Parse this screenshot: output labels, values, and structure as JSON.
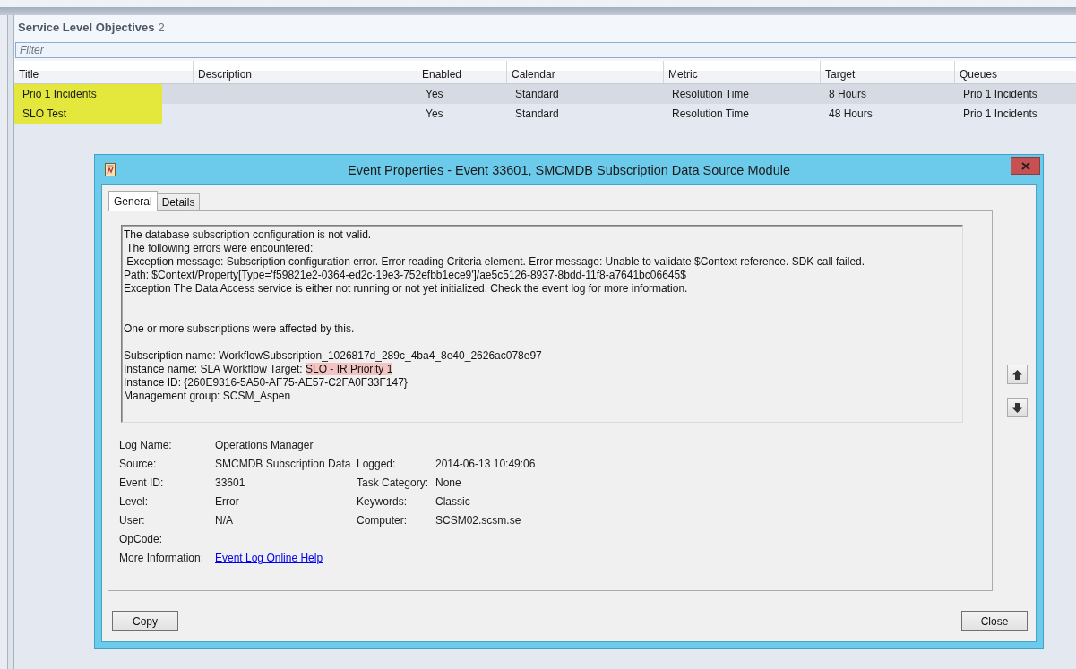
{
  "list_panel": {
    "title": "Service Level Objectives",
    "count": "2",
    "filter": {
      "placeholder": "Filter"
    }
  },
  "table": {
    "columns": [
      "Title",
      "Description",
      "Enabled",
      "Calendar",
      "Metric",
      "Target",
      "Queues"
    ],
    "rows": [
      {
        "title": "Prio 1 Incidents",
        "enabled": "Yes",
        "calendar": "Standard",
        "metric": "Resolution Time",
        "target": "8 Hours",
        "queues": "Prio 1 Incidents",
        "selected": true,
        "highlighted": true
      },
      {
        "title": "SLO Test",
        "enabled": "Yes",
        "calendar": "Standard",
        "metric": "Resolution Time",
        "target": "48 Hours",
        "queues": "Prio 1 Incidents",
        "selected": false,
        "highlighted": true
      }
    ]
  },
  "dialog": {
    "title": "Event Properties - Event 33601, SMCMDB Subscription Data Source Module",
    "tabs": [
      {
        "label": "General",
        "selected": true
      },
      {
        "label": "Details",
        "selected": false
      }
    ],
    "description": [
      {
        "text": "The database subscription configuration is not valid.\n The following errors were encountered:\n Exception message: Subscription configuration error. Error reading Criteria element. Error message: Unable to validate $Context reference. SDK call failed.\nPath: $Context/Property[Type='f59821e2-0364-ed2c-19e3-752efbb1ece9']/ae5c5126-8937-8bdd-11f8-a7641bc06645$\nException The Data Access service is either not running or not yet initialized. Check the event log for more information.\n\n\nOne or more subscriptions were affected by this.\n\nSubscription name: WorkflowSubscription_1026817d_289c_4ba4_8e40_2626ac078e97\nInstance name: SLA Workflow Target: ",
        "highlighted": false
      },
      {
        "text": "SLO - IR Priority 1",
        "highlighted": true
      },
      {
        "text": "\nInstance ID: {260E9316-5A50-AF75-AE57-C2FA0F33F147}\nManagement group: SCSM_Aspen",
        "highlighted": false
      }
    ],
    "properties": [
      [
        {
          "label": "Log Name:",
          "value": "Operations Manager"
        }
      ],
      [
        {
          "label": "Source:",
          "value": "SMCMDB Subscription Data"
        },
        {
          "label": "Logged:",
          "value": "2014-06-13 10:49:06"
        }
      ],
      [
        {
          "label": "Event ID:",
          "value": "33601"
        },
        {
          "label": "Task Category:",
          "value": "None"
        }
      ],
      [
        {
          "label": "Level:",
          "value": "Error"
        },
        {
          "label": "Keywords:",
          "value": "Classic"
        }
      ],
      [
        {
          "label": "User:",
          "value": "N/A"
        },
        {
          "label": "Computer:",
          "value": "SCSM02.scsm.se"
        }
      ],
      [
        {
          "label": "OpCode:"
        }
      ],
      [
        {
          "label": "More Information:",
          "link": "Event Log Online Help"
        }
      ]
    ],
    "buttons": [
      "Copy",
      "Close"
    ]
  }
}
